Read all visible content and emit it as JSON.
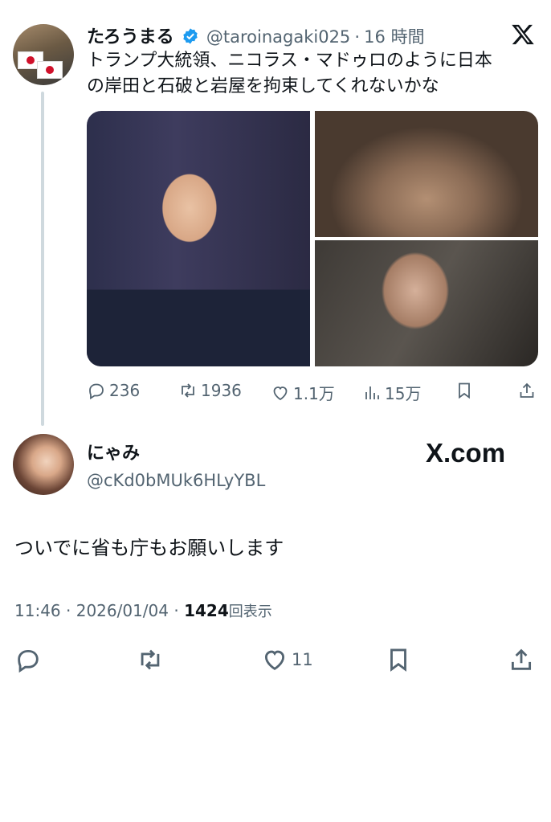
{
  "quoted_tweet": {
    "author_name": "たろうまる",
    "handle": "@taroinagaki025",
    "separator": "·",
    "time_ago": "16 時間",
    "text_line1": "トランプ大統領、ニコラス・マドゥロのように日本",
    "text_line2": "の岸田と石破と岩屋を拘束してくれないかな",
    "stats": {
      "replies": "236",
      "retweets": "1936",
      "likes": "1.1万",
      "views": "15万"
    }
  },
  "reply": {
    "author_name": "にゃみ",
    "handle": "@cKd0bMUk6HLyYBL",
    "brand": "X.com",
    "text": "ついでに省も庁もお願いします",
    "time": "11:46",
    "date": "2026/01/04",
    "separator": "·",
    "view_count": "1424",
    "view_label": "回表示",
    "likes": "11"
  },
  "icons": {
    "x_logo": "x-logo-icon",
    "verified": "verified-badge-icon"
  },
  "colors": {
    "verified_blue": "#1d9bf0",
    "secondary_text": "#536471"
  }
}
